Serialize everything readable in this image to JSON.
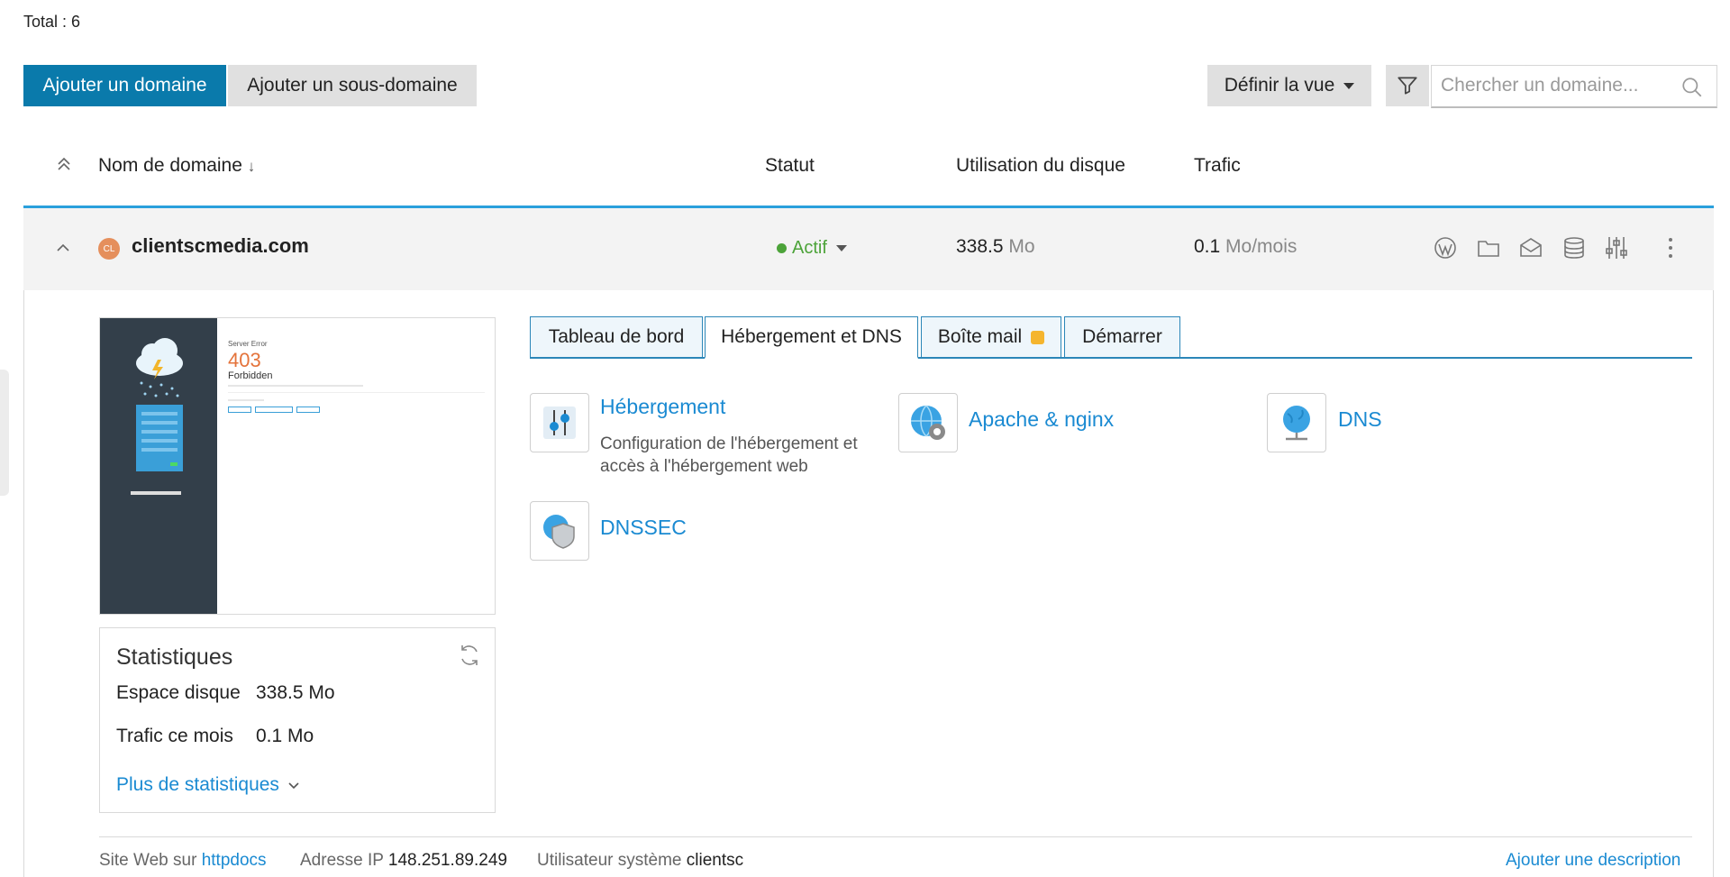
{
  "total": "Total : 6",
  "toolbar": {
    "add_domain": "Ajouter un domaine",
    "add_subdomain": "Ajouter un sous-domaine",
    "define_view": "Définir la vue",
    "search_placeholder": "Chercher un domaine..."
  },
  "columns": {
    "domain": "Nom de domaine",
    "status": "Statut",
    "disk": "Utilisation du disque",
    "traffic": "Trafic"
  },
  "domain_row": {
    "avatar": "CL",
    "name": "clientscmedia.com",
    "status": "Actif",
    "disk_value": "338.5",
    "disk_unit": "Mo",
    "traffic_value": "0.1",
    "traffic_unit": "Mo/mois",
    "action_icons": [
      "wordpress-icon",
      "folder-icon",
      "mail-icon",
      "database-icon",
      "sliders-icon",
      "more-icon"
    ]
  },
  "preview": {
    "error_title": "Server Error",
    "error_code": "403",
    "error_text": "Forbidden"
  },
  "stats": {
    "title": "Statistiques",
    "disk_label": "Espace disque",
    "disk_value": "338.5 Mo",
    "traffic_label": "Trafic ce mois",
    "traffic_value": "0.1 Mo",
    "more_link": "Plus de statistiques"
  },
  "tabs": [
    {
      "label": "Tableau de bord"
    },
    {
      "label": "Hébergement et DNS"
    },
    {
      "label": "Boîte mail"
    },
    {
      "label": "Démarrer"
    }
  ],
  "services": {
    "hosting": {
      "title": "Hébergement",
      "desc1": "Configuration de l'hébergement et",
      "desc2": "accès à l'hébergement web"
    },
    "apache": {
      "title": "Apache & nginx"
    },
    "dns": {
      "title": "DNS"
    },
    "dnssec": {
      "title": "DNSSEC"
    }
  },
  "footer": {
    "website_label": "Site Web sur",
    "website_value": "httpdocs",
    "ip_label": "Adresse IP",
    "ip_value": "148.251.89.249",
    "user_label": "Utilisateur système",
    "user_value": "clientsc",
    "add_description": "Ajouter une description"
  },
  "colors": {
    "primary": "#0a7aab",
    "link": "#1a8ad2",
    "active_status": "#4ca339",
    "badge": "#f5b52e"
  }
}
